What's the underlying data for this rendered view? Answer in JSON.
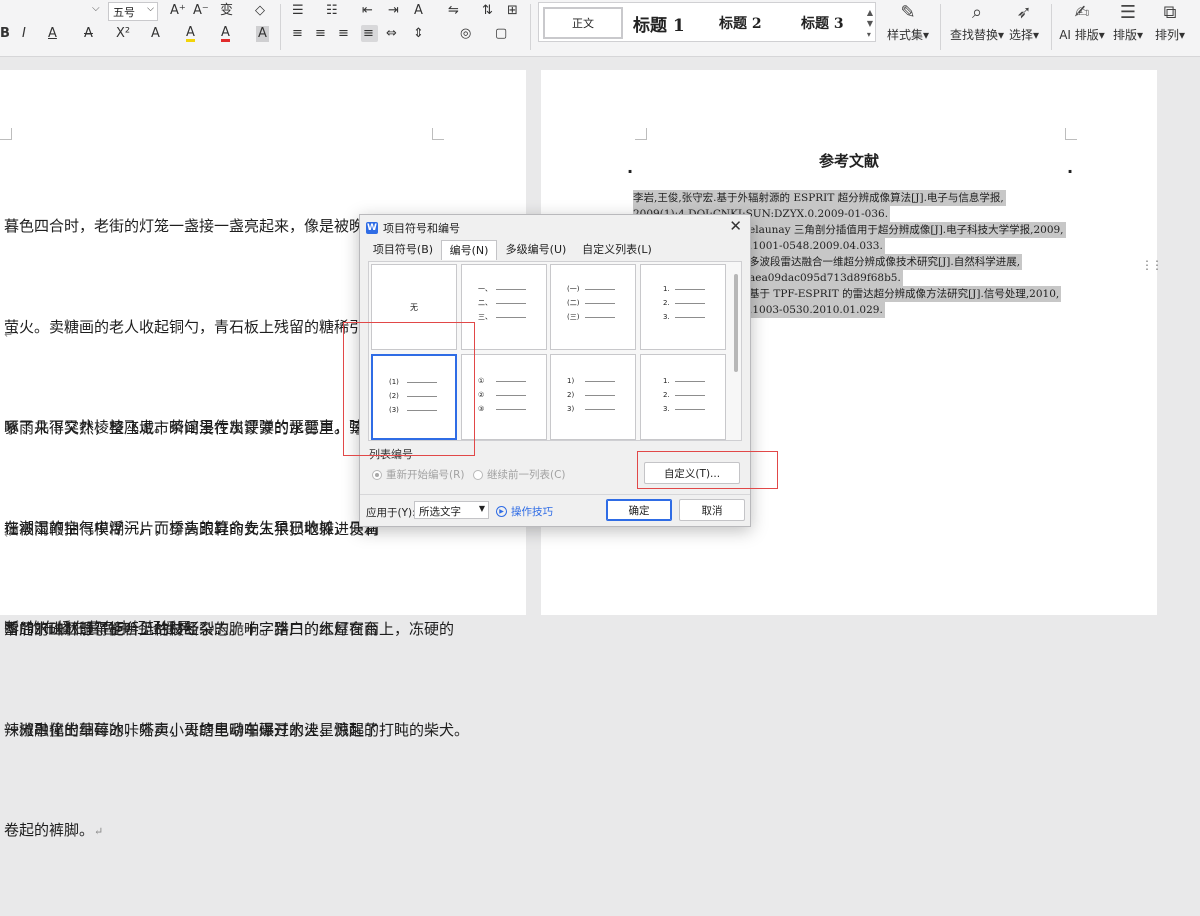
{
  "ribbon": {
    "font_size": "五号",
    "row1_glyphs": [
      "A⁺",
      "A⁻",
      "变",
      "◇"
    ],
    "row2_glyphs": [
      "B",
      "I",
      "A",
      "X²",
      "A",
      "A",
      "A",
      "A"
    ],
    "para_row1": [
      "☰",
      "☷",
      "⇤",
      "⇥",
      "A",
      "⇋",
      "⇅",
      "⊞"
    ],
    "para_row2": [
      "≡",
      "≡",
      "≡",
      "≡",
      "⇔",
      "⇕",
      "◎",
      "▢"
    ],
    "styles": {
      "normal": "正文",
      "h1": "标题 1",
      "h2": "标题 2",
      "h3": "标题 3"
    },
    "style_set": "样式集",
    "find_replace": "查找替换",
    "select": "选择",
    "ai_layout": "AI 排版",
    "layout": "排版",
    "arrange": "排列"
  },
  "left_doc": {
    "p1": [
      "暮色四合时，老街的灯笼一盏接一盏亮起来，像是被晚风点燃的橘色",
      "萤火。卖糖画的老人收起铜勺，青石板上残留的糖稀引来几只麻雀，",
      "啄了几下又扑棱棱飞走。茶馆里传出评弹的琵琶声，弦音",
      "在潮湿的空气中浮沉，而桥头的算命先生早已收摊，只留",
      "断”的布幡在暮色中轻轻摇晃。"
    ],
    "p2": [
      "暴雨来得突然，整座城市瞬间浸在灰蒙蒙的水雾里。写字",
      "墙被雨鞭抽得模糊一片，穿高跟鞋的女人狼狈地躲进便利",
      "落的水珠洇湿了柜台上的财经杂志。十字路口的红灯在雨",
      "一滩融化的草莓冰，外卖小哥的电动车碾过水洼，溅起的",
      "卷起的裤脚。"
    ],
    "p3": [
      "雪后的山林静得能听见枯枝断裂的脆响。猎户的木屋窗台上，冻硬的",
      "辣椒串撞出细碎的咔嗒声，火塘里噼啪爆开的火星惊醒了打盹的柴犬。"
    ]
  },
  "right_doc": {
    "title": "参考文献",
    "refs": [
      "李岩,王俊,张守宏.基于外辐射源的 ESPRIT 超分辨成像算法[J].电子与信息学报,",
      "2009(1):4.DOI:CNKI:SUN:DZYX.0.2009-01-036.",
      "elaunay 三角剖分插值用于超分辨成像[J].电子科技大学学报,2009,",
      ".1001-0548.2009.04.033.",
      "多波段雷达融合一维超分辨成像技术研究[J].自然科学进展,",
      "aea09dac095d713d89f68b5.",
      "基于 TPF-ESPRIT 的雷达超分辨成像方法研究[J].信号处理,2010,",
      ".1003-0530.2010.01.029."
    ]
  },
  "dialog": {
    "title": "项目符号和编号",
    "tabs": [
      "项目符号(B)",
      "编号(N)",
      "多级编号(U)",
      "自定义列表(L)"
    ],
    "active_tab": 1,
    "cells": [
      {
        "type": "none",
        "label": "无"
      },
      {
        "type": "list",
        "labels": [
          "一、",
          "二、",
          "三、"
        ]
      },
      {
        "type": "list",
        "labels": [
          "(一)",
          "(二)",
          "(三)"
        ]
      },
      {
        "type": "list",
        "labels": [
          "1.",
          "2.",
          "3."
        ]
      },
      {
        "type": "list",
        "labels": [
          "(1)",
          "(2)",
          "(3)"
        ]
      },
      {
        "type": "list",
        "labels": [
          "①",
          "②",
          "③"
        ]
      },
      {
        "type": "list",
        "labels": [
          "1)",
          "2)",
          "3)"
        ]
      },
      {
        "type": "list",
        "labels": [
          "1.",
          "2.",
          "3."
        ]
      }
    ],
    "selected_cell": 4,
    "section_label": "列表编号",
    "radio_restart": "重新开始编号(R)",
    "radio_continue": "继续前一列表(C)",
    "customize_button": "自定义(T)...",
    "apply_label": "应用于(Y):",
    "apply_value": "所选文字",
    "tips_link": "操作技巧",
    "ok_button": "确定",
    "cancel_button": "取消"
  },
  "colors": {
    "accent": "#2f6ce5",
    "annotation_red": "#e14848",
    "selection_gray": "#c7c7c7"
  }
}
